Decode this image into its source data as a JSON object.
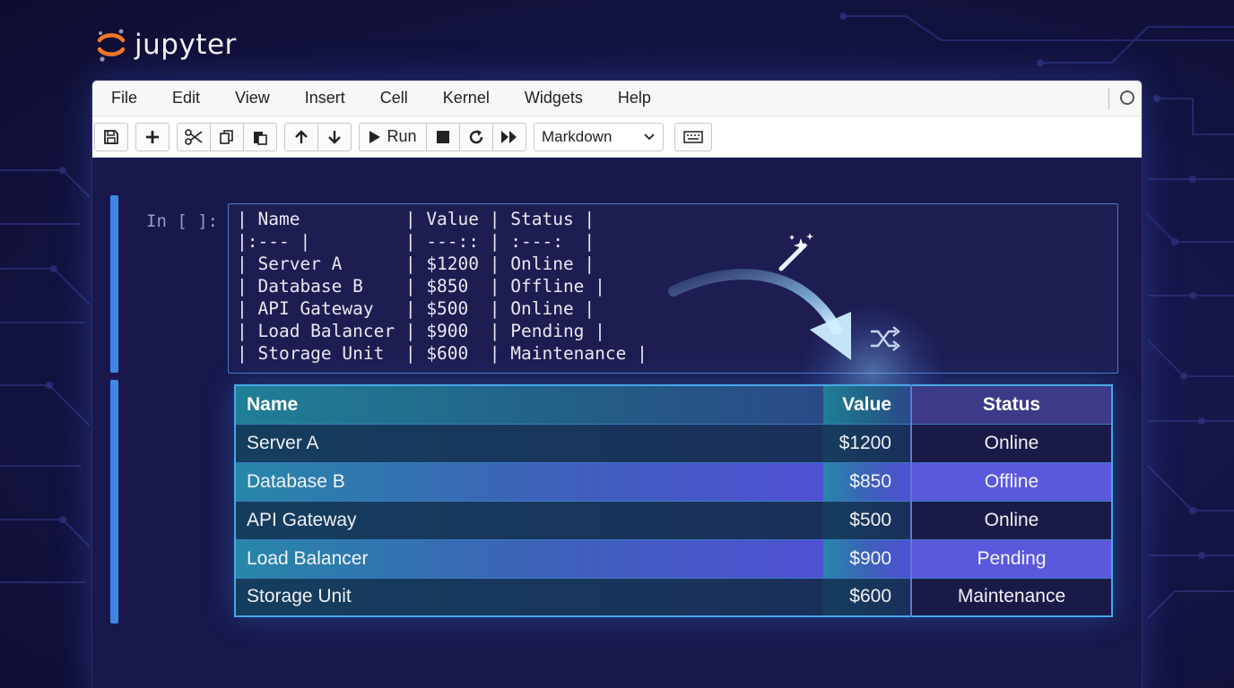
{
  "app": {
    "logo_text": "jupyter"
  },
  "menu": [
    "File",
    "Edit",
    "View",
    "Insert",
    "Cell",
    "Kernel",
    "Widgets",
    "Help"
  ],
  "toolbar": {
    "icons": [
      "save-icon",
      "plus-icon",
      "scissors-icon",
      "copy-icon",
      "paste-icon",
      "arrow-up-icon",
      "arrow-down-icon",
      "play-icon",
      "stop-icon",
      "restart-icon",
      "fast-forward-icon",
      "keyboard-icon"
    ],
    "run_label": "Run",
    "cell_type": "Markdown"
  },
  "cell": {
    "prompt": "In [ ]:",
    "source_lines": [
      "| Name          | Value | Status |",
      "|:--- |         | ---:: | :---:  |",
      "| Server A      | $1200 | Online |",
      "| Database B    | $850  | Offline |",
      "| API Gateway   | $500  | Online |",
      "| Load Balancer | $900  | Pending |",
      "| Storage Unit  | $600  | Maintenance |"
    ]
  },
  "output_table": {
    "headers": [
      "Name",
      "Value",
      "Status"
    ],
    "rows": [
      [
        "Server A",
        "$1200",
        "Online"
      ],
      [
        "Database B",
        "$850",
        "Offline"
      ],
      [
        "API Gateway",
        "$500",
        "Online"
      ],
      [
        "Load Balancer",
        "$900",
        "Pending"
      ],
      [
        "Storage Unit",
        "$600",
        "Maintenance"
      ]
    ]
  },
  "colors": {
    "background": "#16164a",
    "accent": "#3d86e6",
    "highlight_row": "#5a58dc",
    "logo_orange": "#f37726"
  }
}
